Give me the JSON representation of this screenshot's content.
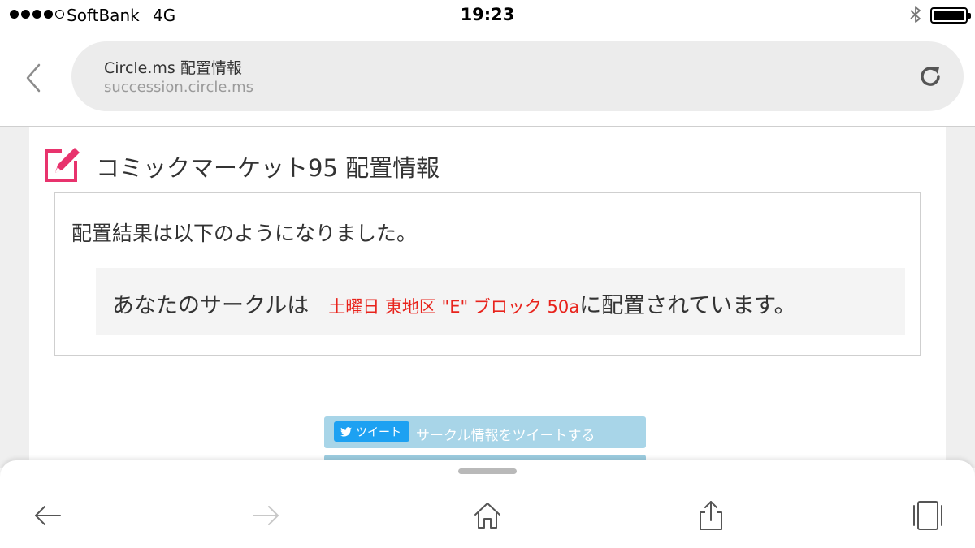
{
  "status_bar": {
    "carrier": "SoftBank",
    "network": "4G",
    "time": "19:23",
    "signal_bars_filled": 4,
    "signal_bars_total": 5,
    "battery_level": 1.0
  },
  "address_bar": {
    "page_title": "Circle.ms 配置情報",
    "domain": "succession.circle.ms"
  },
  "page": {
    "heading": "コミックマーケット95 配置情報",
    "result_intro": "配置結果は以下のようになりました。",
    "placement_prefix": "あなたのサークルは",
    "placement_location": "土曜日 東地区 \"E\" ブロック 50a",
    "placement_suffix": "に配置されています。",
    "tweet_badge_label": "ツイート",
    "tweet_action_text": "サークル情報をツイートする"
  },
  "toolbar": {
    "icons": [
      "back-arrow-icon",
      "forward-arrow-icon",
      "home-icon",
      "share-icon",
      "tabs-icon"
    ]
  },
  "colors": {
    "accent_pink": "#e8336d",
    "location_red": "#e8231c",
    "tweet_blue": "#1da1f2",
    "tweet_bar_bg": "#a8d5e8"
  }
}
